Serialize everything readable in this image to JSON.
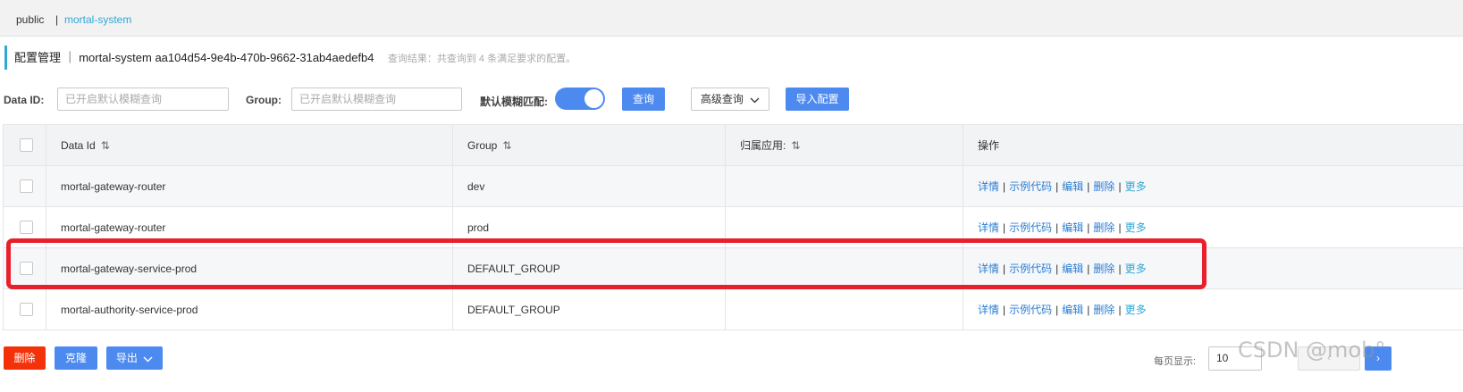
{
  "namespaces": {
    "public": "public",
    "separator": "|",
    "current": "mortal-system"
  },
  "header": {
    "title": "配置管理 ｜ mortal-system  aa104d54-9e4b-470b-9662-31ab4aedefb4",
    "result": "查询结果：共查询到 4 条满足要求的配置。"
  },
  "search": {
    "dataid_label": "Data ID:",
    "dataid_placeholder": "已开启默认模糊查询",
    "group_label": "Group:",
    "group_placeholder": "已开启默认模糊查询",
    "fuzzy_label": "默认模糊匹配:",
    "fuzzy_on": true,
    "query_button": "查询",
    "advanced_button": "高级查询",
    "import_button": "导入配置"
  },
  "table": {
    "columns": [
      "Data Id",
      "Group",
      "归属应用:",
      "操作"
    ],
    "sort_icon": "⇅",
    "rows": [
      {
        "data_id": "mortal-gateway-router",
        "group": "dev",
        "app": ""
      },
      {
        "data_id": "mortal-gateway-router",
        "group": "prod",
        "app": ""
      },
      {
        "data_id": "mortal-gateway-service-prod",
        "group": "DEFAULT_GROUP",
        "app": ""
      },
      {
        "data_id": "mortal-authority-service-prod",
        "group": "DEFAULT_GROUP",
        "app": ""
      }
    ],
    "actions": {
      "detail": "详情",
      "sample": "示例代码",
      "edit": "编辑",
      "delete": "删除",
      "more": "更多"
    }
  },
  "footer": {
    "delete_button": "删除",
    "clone_button": "克隆",
    "export_button": "导出",
    "page_size_label": "每页显示:",
    "page_size": "10"
  },
  "watermark": "CSDN @mob°",
  "colors": {
    "accent": "#4d8af0",
    "danger": "#f3320a",
    "highlight": "#e8202c",
    "link": "#2b7ed3"
  }
}
